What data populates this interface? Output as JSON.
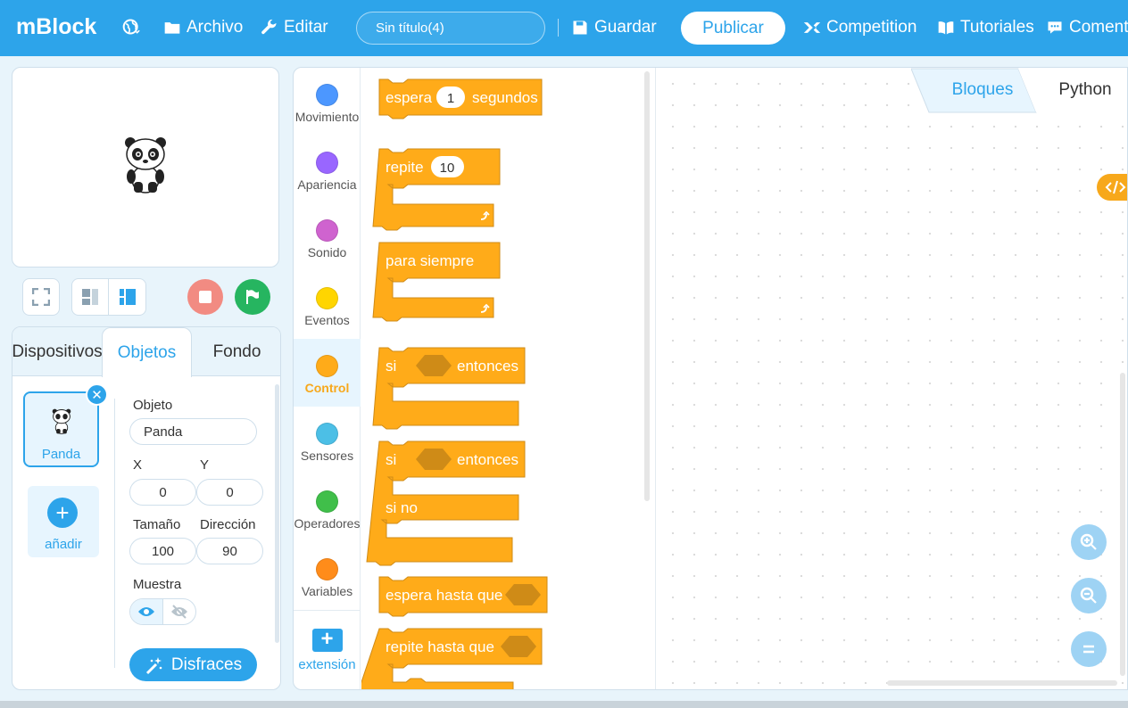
{
  "topbar": {
    "logo": "mBlock",
    "menu_file": "Archivo",
    "menu_edit": "Editar",
    "project_title": "Sin título(4)",
    "save": "Guardar",
    "publish": "Publicar",
    "competition": "Competition",
    "tutorials": "Tutoriales",
    "comments": "Coment"
  },
  "sprite_tabs": {
    "devices": "Dispositivos",
    "objects": "Objetos",
    "background": "Fondo"
  },
  "sprite_list": {
    "sprite_name": "Panda",
    "add_label": "añadir"
  },
  "properties": {
    "object_label": "Objeto",
    "object_value": "Panda",
    "x_label": "X",
    "x_value": "0",
    "y_label": "Y",
    "y_value": "0",
    "size_label": "Tamaño",
    "size_value": "100",
    "direction_label": "Dirección",
    "direction_value": "90",
    "show_label": "Muestra",
    "costumes_button": "Disfraces"
  },
  "categories": [
    {
      "label": "Movimiento",
      "color": "#4c97ff"
    },
    {
      "label": "Apariencia",
      "color": "#9966ff"
    },
    {
      "label": "Sonido",
      "color": "#cf63cf"
    },
    {
      "label": "Eventos",
      "color": "#ffd500"
    },
    {
      "label": "Control",
      "color": "#ffab19"
    },
    {
      "label": "Sensores",
      "color": "#4cbfe6"
    },
    {
      "label": "Operadores",
      "color": "#40bf4a"
    },
    {
      "label": "Variables",
      "color": "#ff8c1a"
    }
  ],
  "extension_label": "extensión",
  "blocks": {
    "wait": "espera",
    "wait_value": "1",
    "seconds": "segundos",
    "repeat": "repite",
    "repeat_value": "10",
    "forever": "para siempre",
    "if": "si",
    "then": "entonces",
    "if2": "si",
    "then2": "entonces",
    "else": "si no",
    "wait_until": "espera hasta que",
    "repeat_until": "repite hasta que"
  },
  "workspace_tabs": {
    "blocks": "Bloques",
    "python": "Python"
  },
  "colors": {
    "accent": "#2da4ea",
    "control": "#ffab19",
    "control_dark": "#cf8b17"
  }
}
